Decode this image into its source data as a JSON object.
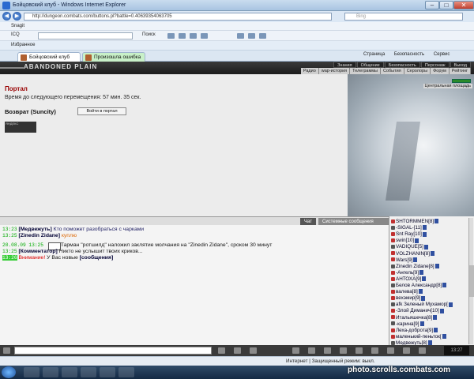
{
  "window": {
    "title": "Бойцовский клуб - Windows Internet Explorer"
  },
  "address": {
    "url": "http://dungeon.combats.com/buttons.pl?battle=0.40639354063705",
    "search_placeholder": "Bing"
  },
  "toolbar1": {
    "brand": "Snagit"
  },
  "toolbar2": {
    "icq": "ICQ",
    "search_btn": "Поиск"
  },
  "favbar": {
    "favorites": "Избранное"
  },
  "tabs": [
    {
      "label": "Бойцовский клуб"
    },
    {
      "label": "Произошла ошибка"
    }
  ],
  "commandbar": {
    "page": "Страница",
    "safety": "Безопасность",
    "service": "Сервис"
  },
  "game": {
    "logo": "ABANDONED PLAIN",
    "nav": [
      "Знания",
      "Общение",
      "Безопасность",
      "Персонаж",
      "Выход"
    ],
    "subnav": [
      "Радио",
      "wap-история",
      "Телеграммы",
      "События",
      "Серолоры",
      "Форум",
      "Рейтинг"
    ],
    "location_label": "Центральная площадь",
    "portal_title": "Портал",
    "timer_text": "Время до следующего перемещения: 57 мин. 35 сек.",
    "return_label": "Возврат (Suncity)",
    "portal_button": "Войти в портал",
    "counter_text": "ЯНДЕКС"
  },
  "chat": {
    "tab_chat": "Чат",
    "tab_system": "Системные сообщения",
    "messages": [
      {
        "time": "13:23",
        "nick": "[Медвежуть]",
        "text": "Кто поможет разобраться с чарками"
      },
      {
        "time": "13:25",
        "nick": "[Zinedin Zidane]",
        "text": "куплю"
      },
      {
        "time": "20.08.09 13:25",
        "text": "Тарман \"ротшилд\" наложил заклятие молчания на \"Zinedin Zidane\", сроком 30 минут"
      },
      {
        "time": "13:25",
        "nick": "[Комментатор]",
        "text": "Никто не услышит твоих криков..."
      },
      {
        "time": "13:26",
        "label": "Внимание!",
        "text": "У Вас новые",
        "link": "[сообщения]"
      }
    ]
  },
  "players": [
    "SHTORMMEN[8]",
    "-SIGAL-[11]",
    "Snt Ray[10]",
    "swin[10]",
    "VADIQUE[5]",
    "VOLZHANIN[8]",
    "Wars[9]",
    "Zinedin Zidane[8]",
    "-Ангель[9]",
    "АНТОХА[9]",
    "Белов Александр[8]",
    "валева[8]",
    "вехэмир[9]",
    "afk Зеленый Мухамор[",
    "-Злой Диманич[10]",
    "Итальяшечка[8]",
    "-карина[9]",
    "Леха-доброта[9]",
    "маленький-пеньток[",
    "Медвежуть[8]"
  ],
  "inputbar": {
    "clock": "13:27"
  },
  "status": {
    "text": "Интернет | Защищенный режим: выкл."
  },
  "watermark": "photo.scrolls.combats.com"
}
